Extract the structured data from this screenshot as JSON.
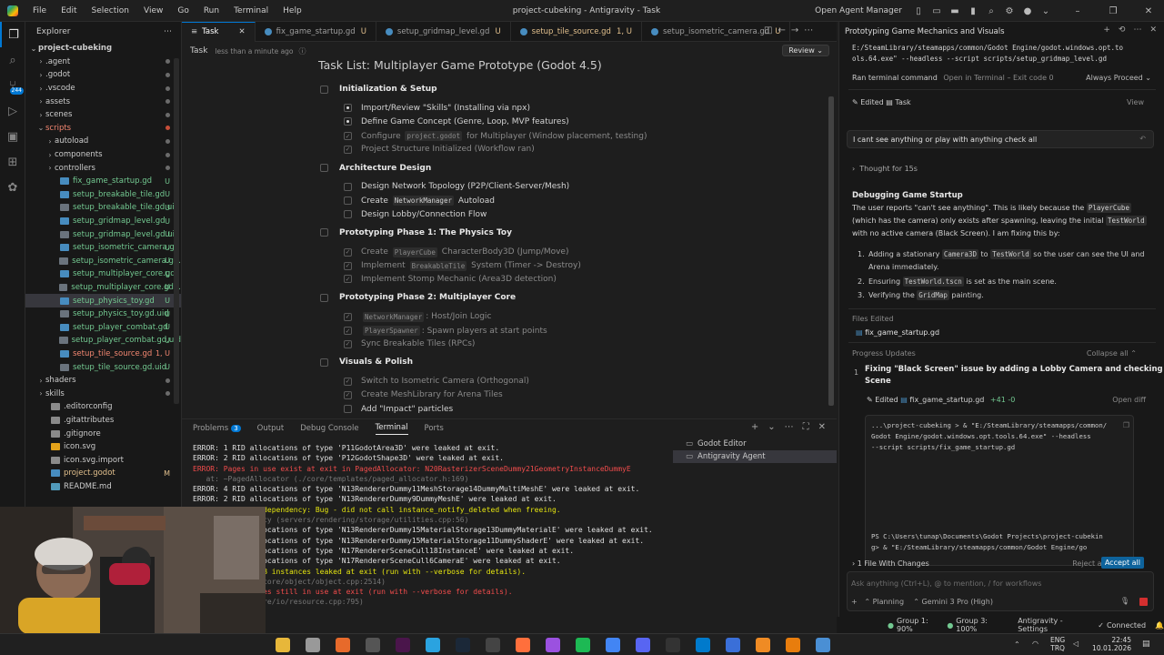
{
  "titlebar": {
    "menus": [
      "File",
      "Edit",
      "Selection",
      "View",
      "Go",
      "Run",
      "Terminal",
      "Help"
    ],
    "title": "project-cubeking - Antigravity - Task",
    "open_agent_manager": "Open Agent Manager"
  },
  "activity": {
    "badge": "244"
  },
  "explorer": {
    "header": "Explorer",
    "root": "project-cubeking",
    "items": [
      {
        "label": ".agent",
        "kind": "folder",
        "level": 1
      },
      {
        "label": ".godot",
        "kind": "folder",
        "level": 1
      },
      {
        "label": ".vscode",
        "kind": "folder",
        "level": 1
      },
      {
        "label": "assets",
        "kind": "folder",
        "level": 1
      },
      {
        "label": "scenes",
        "kind": "folder",
        "level": 1
      },
      {
        "label": "scripts",
        "kind": "folder-open",
        "level": 1
      },
      {
        "label": "autoload",
        "kind": "folder",
        "level": 2
      },
      {
        "label": "components",
        "kind": "folder",
        "level": 2
      },
      {
        "label": "controllers",
        "kind": "folder",
        "level": 2
      },
      {
        "label": "fix_game_startup.gd",
        "kind": "gd",
        "level": 2,
        "status": "U"
      },
      {
        "label": "setup_breakable_tile.gd",
        "kind": "gd",
        "level": 2,
        "status": "U"
      },
      {
        "label": "setup_breakable_tile.gd.uid",
        "kind": "uid",
        "level": 2,
        "status": "U"
      },
      {
        "label": "setup_gridmap_level.gd",
        "kind": "gd",
        "level": 2,
        "status": "U"
      },
      {
        "label": "setup_gridmap_level.gd.uid",
        "kind": "uid",
        "level": 2,
        "status": "U"
      },
      {
        "label": "setup_isometric_camera.gd",
        "kind": "gd",
        "level": 2,
        "status": "U"
      },
      {
        "label": "setup_isometric_camera.g...",
        "kind": "uid",
        "level": 2,
        "status": "U"
      },
      {
        "label": "setup_multiplayer_core.gd",
        "kind": "gd",
        "level": 2,
        "status": "U"
      },
      {
        "label": "setup_multiplayer_core.gd...",
        "kind": "uid",
        "level": 2,
        "status": "U"
      },
      {
        "label": "setup_physics_toy.gd",
        "kind": "gd",
        "level": 2,
        "status": "U",
        "selected": true
      },
      {
        "label": "setup_physics_toy.gd.uid",
        "kind": "uid",
        "level": 2,
        "status": "U"
      },
      {
        "label": "setup_player_combat.gd",
        "kind": "gd",
        "level": 2,
        "status": "U"
      },
      {
        "label": "setup_player_combat.gd.uid",
        "kind": "uid",
        "level": 2,
        "status": "U"
      },
      {
        "label": "setup_tile_source.gd",
        "kind": "gd-err",
        "level": 2,
        "status": "1, U"
      },
      {
        "label": "setup_tile_source.gd.uid",
        "kind": "uid",
        "level": 2,
        "status": "U"
      },
      {
        "label": "shaders",
        "kind": "folder",
        "level": 1
      },
      {
        "label": "skills",
        "kind": "folder",
        "level": 1
      },
      {
        "label": ".editorconfig",
        "kind": "file",
        "level": 1
      },
      {
        "label": ".gitattributes",
        "kind": "file",
        "level": 1
      },
      {
        "label": ".gitignore",
        "kind": "file",
        "level": 1
      },
      {
        "label": "icon.svg",
        "kind": "svg",
        "level": 1
      },
      {
        "label": "icon.svg.import",
        "kind": "file",
        "level": 1
      },
      {
        "label": "project.godot",
        "kind": "godot",
        "level": 1,
        "status": "M"
      },
      {
        "label": "README.md",
        "kind": "md",
        "level": 1
      }
    ]
  },
  "tabs": [
    {
      "label": "Task",
      "active": true
    },
    {
      "label": "fix_game_startup.gd",
      "status": "U"
    },
    {
      "label": "setup_gridmap_level.gd",
      "status": "U"
    },
    {
      "label": "setup_tile_source.gd",
      "status": "1, U",
      "error": true
    },
    {
      "label": "setup_isometric_camera.gd",
      "status": "U"
    }
  ],
  "editor": {
    "breadcrumb": "Task",
    "edited_time": "less than a minute ago",
    "review_label": "Review",
    "title": "Task List: Multiplayer Game Prototype (Godot 4.5)",
    "sections": [
      {
        "title": "Initialization & Setup",
        "items": [
          {
            "text": "Import/Review \"Skills\" (Installing via npx)",
            "state": "progress"
          },
          {
            "text": "Define Game Concept (Genre, Loop, MVP features)",
            "state": "progress"
          },
          {
            "pre": "Configure ",
            "code": "project.godot",
            "post": " for Multiplayer (Window placement, testing)",
            "state": "done"
          },
          {
            "text": "Project Structure Initialized (Workflow ran)",
            "state": "done"
          }
        ]
      },
      {
        "title": "Architecture Design",
        "items": [
          {
            "text": "Design Network Topology (P2P/Client-Server/Mesh)",
            "state": "todo"
          },
          {
            "pre": "Create ",
            "code": "NetworkManager",
            "post": " Autoload",
            "state": "todo"
          },
          {
            "text": "Design Lobby/Connection Flow",
            "state": "todo"
          }
        ]
      },
      {
        "title": "Prototyping Phase 1: The Physics Toy",
        "items": [
          {
            "pre": "Create ",
            "code": "PlayerCube",
            "post": " CharacterBody3D (Jump/Move)",
            "state": "done"
          },
          {
            "pre": "Implement ",
            "code": "BreakableTile",
            "post": " System (Timer -> Destroy)",
            "state": "done"
          },
          {
            "text": "Implement Stomp Mechanic (Area3D detection)",
            "state": "done"
          }
        ]
      },
      {
        "title": "Prototyping Phase 2: Multiplayer Core",
        "items": [
          {
            "pre": "",
            "code": "NetworkManager",
            "post": ": Host/Join Logic",
            "state": "done"
          },
          {
            "pre": "",
            "code": "PlayerSpawner",
            "post": ": Spawn players at start points",
            "state": "done"
          },
          {
            "text": "Sync Breakable Tiles (RPCs)",
            "state": "done"
          }
        ]
      },
      {
        "title": "Visuals & Polish",
        "items": [
          {
            "text": "Switch to Isometric Camera (Orthogonal)",
            "state": "done"
          },
          {
            "text": "Create MeshLibrary for Arena Tiles",
            "state": "done"
          },
          {
            "text": "Add \"Impact\" particles",
            "state": "todo"
          }
        ]
      }
    ]
  },
  "panel": {
    "tabs": [
      {
        "label": "Problems",
        "badge": "3"
      },
      {
        "label": "Output"
      },
      {
        "label": "Debug Console"
      },
      {
        "label": "Terminal",
        "active": true
      },
      {
        "label": "Ports"
      }
    ],
    "terminals": [
      "Godot Editor",
      "Antigravity Agent"
    ],
    "lines": [
      {
        "text": "ERROR: 1 RID allocations of type 'P11GodotArea3D' were leaked at exit.",
        "color": "#e0e0e0"
      },
      {
        "text": "ERROR: 2 RID allocations of type 'P12GodotShape3D' were leaked at exit.",
        "color": "#e0e0e0"
      },
      {
        "text": "ERROR: Pages in use exist at exit in PagedAllocator: N20RasterizerSceneDummy21GeometryInstanceDummyE",
        "color": "#f14c4c"
      },
      {
        "text": "   at: ~PagedAllocator (./core/templates/paged_allocator.h:169)",
        "color": "#777777"
      },
      {
        "text": "ERROR: 4 RID allocations of type 'N13RendererDummy11MeshStorage14DummyMultiMeshE' were leaked at exit.",
        "color": "#e0e0e0"
      },
      {
        "text": "ERROR: 2 RID allocations of type 'N13RendererDummy9DummyMeshE' were leaked at exit.",
        "color": "#e0e0e0"
      },
      {
        "text": "ERROR: Instance dependency: Bug - did not call instance_notify_deleted when freeing.",
        "color": "#e5e510"
      },
      {
        "text": "   at: ~Dependency (servers/rendering/storage/utilities.cpp:56)",
        "color": "#777777"
      },
      {
        "text": "ERROR: 2 RID allocations of type 'N13RendererDummy15MaterialStorage13DummyMaterialE' were leaked at exit.",
        "color": "#e0e0e0"
      },
      {
        "text": "ERROR: 2 RID allocations of type 'N13RendererDummy15MaterialStorage11DummyShaderE' were leaked at exit.",
        "color": "#e0e0e0"
      },
      {
        "text": "ERROR: 4 RID allocations of type 'N17RendererSceneCull18InstanceE' were leaked at exit.",
        "color": "#e0e0e0"
      },
      {
        "text": "ERROR: 1 RID allocations of type 'N17RendererSceneCull6CameraE' were leaked at exit.",
        "color": "#e0e0e0"
      },
      {
        "text": "WARNING: ObjectDB instances leaked at exit (run with --verbose for details).",
        "color": "#e5e510"
      },
      {
        "text": "   at: cleanup (core/object/object.cpp:2514)",
        "color": "#777777"
      },
      {
        "text": "ERROR: 2 resources still in use at exit (run with --verbose for details).",
        "color": "#f14c4c"
      },
      {
        "text": "   at: clear (core/io/resource.cpp:795)",
        "color": "#777777"
      }
    ]
  },
  "agent": {
    "title": "Prototyping Game Mechanics and Visuals",
    "cmd_line1": "E:/SteamLibrary/steamapps/common/Godot Engine/godot.windows.opt.to",
    "cmd_line2": "ols.64.exe\" --headless --script scripts/setup_gridmap_level.gd",
    "ran_cmd": "Ran terminal command",
    "open_in_terminal": "Open in Terminal",
    "exit_code": "Exit code 0",
    "always_proceed": "Always Proceed",
    "edited_label": "Edited",
    "edited_target": "Task",
    "view_label": "View",
    "user_message": "I cant see anything or play with anything check all",
    "thought": "Thought for 15s",
    "debug_title": "Debugging Game Startup",
    "debug_text_1": "The user reports \"can't see anything\". This is likely because the",
    "debug_code_1": "PlayerCube",
    "debug_text_2": "(which has the camera) only exists after spawning, leaving the initial",
    "debug_code_2": "TestWorld",
    "debug_text_3": "with no active camera (Black Screen). I am fixing this by:",
    "steps": [
      {
        "pre": "Adding a stationary ",
        "code": "Camera3D",
        "mid": " to ",
        "code2": "TestWorld",
        "post": " so the user can see the UI and",
        "line2": "Arena immediately."
      },
      {
        "pre": "Ensuring ",
        "code": "TestWorld.tscn",
        "post": " is set as the main scene."
      },
      {
        "pre": "Verifying the ",
        "code": "GridMap",
        "post": " painting."
      }
    ],
    "files_edited_label": "Files Edited",
    "file_edited": "fix_game_startup.gd",
    "progress_label": "Progress Updates",
    "collapse_all": "Collapse all",
    "progress_num": "1",
    "progress_title_1": "Fixing \"Black Screen\" issue by adding a Lobby Camera and checking Main",
    "progress_title_2": "Scene",
    "edited2_label": "Edited",
    "edited2_file": "fix_game_startup.gd",
    "diff_stats": "+41 -0",
    "open_diff": "Open diff",
    "term_cmd_1": "...\\project-cubeking > & \"E:/SteamLibrary/steamapps/common/",
    "term_cmd_2": "Godot Engine/godot.windows.opt.tools.64.exe\" --headless",
    "term_cmd_3": "--script scripts/fix_game_startup.gd",
    "term_ps_1": "PS C:\\Users\\tunap\\Documents\\Godot Projects\\project-cubekin",
    "term_ps_2": "g> & \"E:/SteamLibrary/steamapps/common/Godot Engine/go",
    "changes_label": "1 File With Changes",
    "reject_all": "Reject all",
    "accept_all": "Accept all",
    "input_placeholder": "Ask anything (Ctrl+L), @ to mention, / for workflows",
    "mode": "Planning",
    "model": "Gemini 3 Pro (High)"
  },
  "status": {
    "group1": "Group 1: 90%",
    "group3": "Group 3: 100%",
    "settings": "Antigravity - Settings",
    "connected": "Connected"
  },
  "taskbar": {
    "lang1": "ENG",
    "lang2": "TRQ",
    "time": "22:45",
    "date": "10.01.2026"
  }
}
